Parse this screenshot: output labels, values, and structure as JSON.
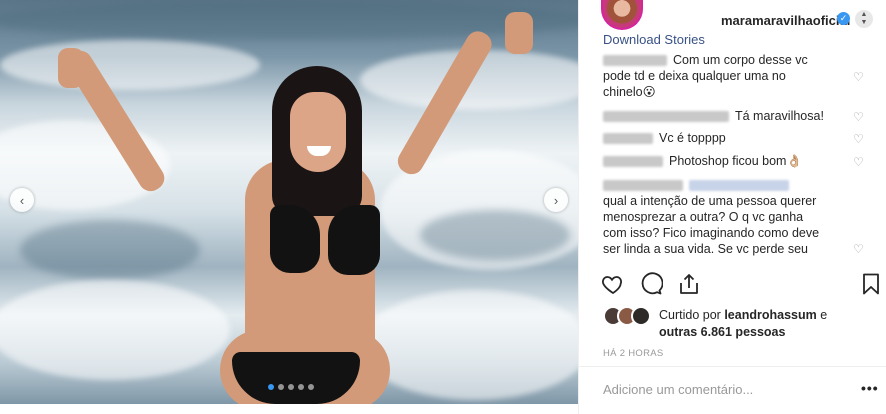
{
  "post": {
    "username": "maramaravilhaoficial",
    "download_label": "Download Stories",
    "verified_icon": "verified-badge-icon"
  },
  "comments": [
    {
      "text_lines": [
        "Com um corpo desse vc",
        "pode td e deixa qualquer uma no",
        "chinelo😮"
      ]
    },
    {
      "text": "Tá maravilhosa!"
    },
    {
      "text": "Vc é topppp"
    },
    {
      "text": "Photoshop ficou bom👌🏼"
    },
    {
      "text_lines": [
        "qual a intenção de uma pessoa querer",
        "menosprezar a outra? O q vc ganha",
        "com isso? Fico imaginando como deve",
        "ser linda a sua vida. Se vc perde seu"
      ]
    }
  ],
  "likes": {
    "prefix": "Curtido por",
    "user": "leandrohassum",
    "suffix": "e",
    "others": "outras 6.861 pessoas"
  },
  "timestamp": "HÁ 2 HORAS",
  "comment_placeholder": "Adicione um comentário...",
  "more_label": "•••",
  "carousel": {
    "pages": 5,
    "active_page": 1
  },
  "colors": {
    "link": "#385185",
    "accent": "#3897f0",
    "muted": "#999999"
  }
}
